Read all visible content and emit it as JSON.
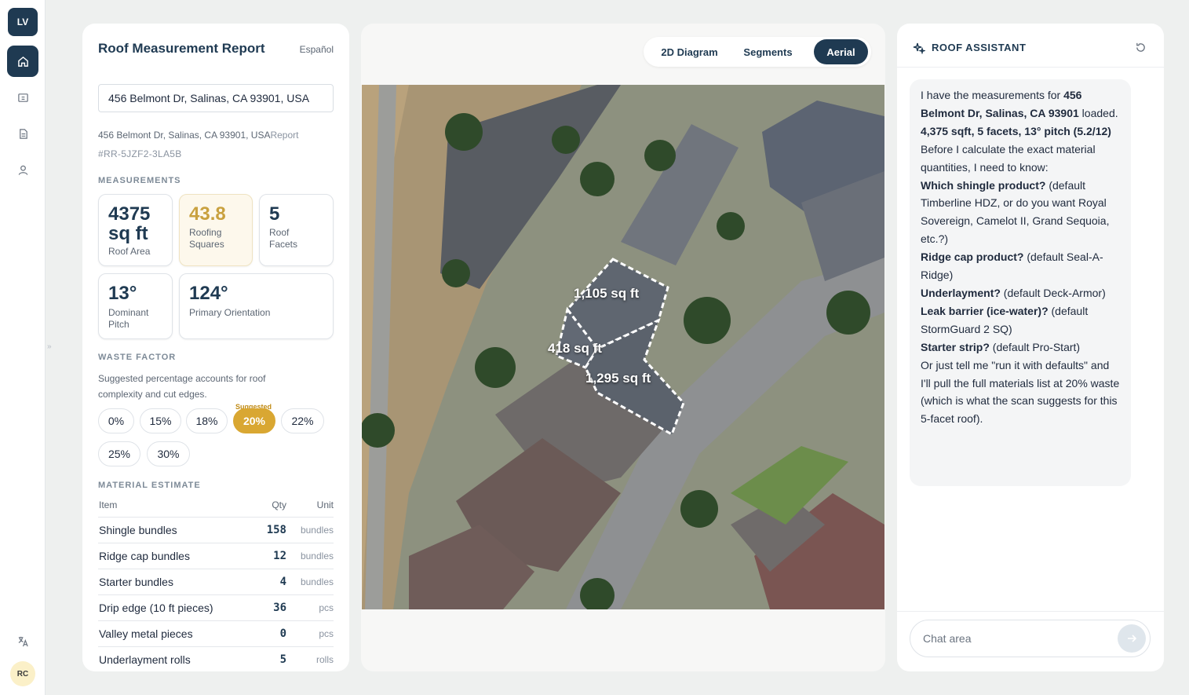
{
  "rail": {
    "logo": "LV",
    "avatar": "RC"
  },
  "report": {
    "title": "Roof Measurement Report",
    "language_toggle": "Español",
    "address_input": "456 Belmont Dr, Salinas, CA 93901, USA",
    "address_line": "456 Belmont Dr, Salinas, CA 93901, USA",
    "address_line_suffix": "Report",
    "report_id": "#RR-5JZF2-3LA5B",
    "measurements_label": "MEASUREMENTS",
    "stats": {
      "roof_area_value_1": "4375",
      "roof_area_value_2": "sq ft",
      "roof_area_label": "Roof Area",
      "squares_value": "43.8",
      "squares_label_1": "Roofing",
      "squares_label_2": "Squares",
      "facets_value": "5",
      "facets_label_1": "Roof",
      "facets_label_2": "Facets",
      "pitch_value": "13°",
      "pitch_label_1": "Dominant",
      "pitch_label_2": "Pitch",
      "orientation_value": "124°",
      "orientation_label": "Primary Orientation"
    },
    "waste_label": "WASTE FACTOR",
    "waste_desc": "Suggested percentage accounts for roof complexity and cut edges.",
    "waste_suggested_tag": "Suggested",
    "waste_options": [
      "0%",
      "15%",
      "18%",
      "20%",
      "22%",
      "25%",
      "30%"
    ],
    "waste_selected": "20%",
    "material_label": "MATERIAL ESTIMATE",
    "material_headers": {
      "item": "Item",
      "qty": "Qty",
      "unit": "Unit"
    },
    "materials": [
      {
        "name": "Shingle bundles",
        "qty": "158",
        "unit": "bundles"
      },
      {
        "name": "Ridge cap bundles",
        "qty": "12",
        "unit": "bundles"
      },
      {
        "name": "Starter bundles",
        "qty": "4",
        "unit": "bundles"
      },
      {
        "name": "Drip edge (10 ft pieces)",
        "qty": "36",
        "unit": "pcs"
      },
      {
        "name": "Valley metal pieces",
        "qty": "0",
        "unit": "pcs"
      },
      {
        "name": "Underlayment rolls",
        "qty": "5",
        "unit": "rolls"
      }
    ]
  },
  "map": {
    "tabs": [
      "2D Diagram",
      "Segments",
      "Aerial"
    ],
    "active_tab": "Aerial",
    "segment_labels": [
      "1,105 sq ft",
      "418 sq ft",
      "1,295 sq ft"
    ]
  },
  "assistant": {
    "title": "ROOF ASSISTANT",
    "msg": {
      "p1_a": "I have the measurements for ",
      "p1_b": "456 Belmont Dr, Salinas, CA 93901",
      "p1_c": " loaded.",
      "p2": "4,375 sqft, 5 facets, 13° pitch (5.2/12)",
      "p3": "Before I calculate the exact material quantities, I need to know:",
      "q1_b": "Which shingle product?",
      "q1_t": " (default Timberline HDZ, or do you want Royal Sovereign, Camelot II, Grand Sequoia, etc.?)",
      "q2_b": "Ridge cap product?",
      "q2_t": " (default Seal-A-Ridge)",
      "q3_b": "Underlayment?",
      "q3_t": " (default Deck-Armor)",
      "q4_b": "Leak barrier (ice-water)?",
      "q4_t": " (default StormGuard 2 SQ)",
      "q5_b": "Starter strip?",
      "q5_t": " (default Pro-Start)",
      "p4": "Or just tell me \"run it with defaults\" and I'll pull the full materials list at 20% waste (which is what the scan suggests for this 5-facet roof)."
    },
    "chat_placeholder": "Chat area"
  },
  "colors": {
    "navy": "#1f3a52",
    "gold": "#d9a732",
    "background": "#eef0ef"
  }
}
